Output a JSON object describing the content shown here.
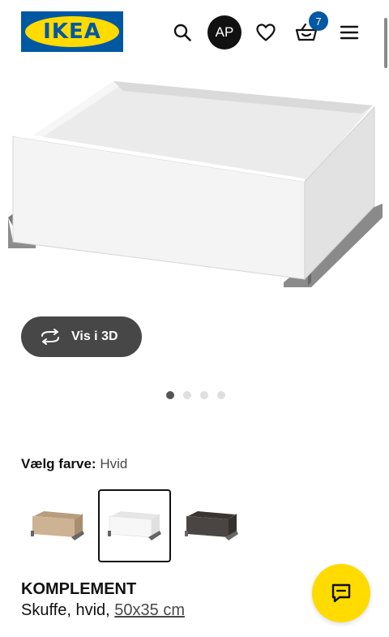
{
  "header": {
    "logo_text": "IKEA",
    "avatar_initials": "AP",
    "cart_count": "7",
    "icons": [
      "search-icon",
      "heart-icon",
      "basket-icon",
      "menu-icon"
    ]
  },
  "gallery": {
    "view3d_label": "Vis i 3D",
    "image_count": 4,
    "active_index": 0
  },
  "color_selector": {
    "label": "Vælg farve:",
    "selected_value": "Hvid",
    "options": [
      {
        "color": "#c8ad8c",
        "selected": false
      },
      {
        "color": "#ffffff",
        "selected": true
      },
      {
        "color": "#4a4443",
        "selected": false
      }
    ]
  },
  "product": {
    "name": "KOMPLEMENT",
    "description": "Skuffe, hvid,",
    "size": "50x35 cm"
  },
  "colors": {
    "brand_blue": "#0058a3",
    "brand_yellow": "#ffdb00"
  }
}
